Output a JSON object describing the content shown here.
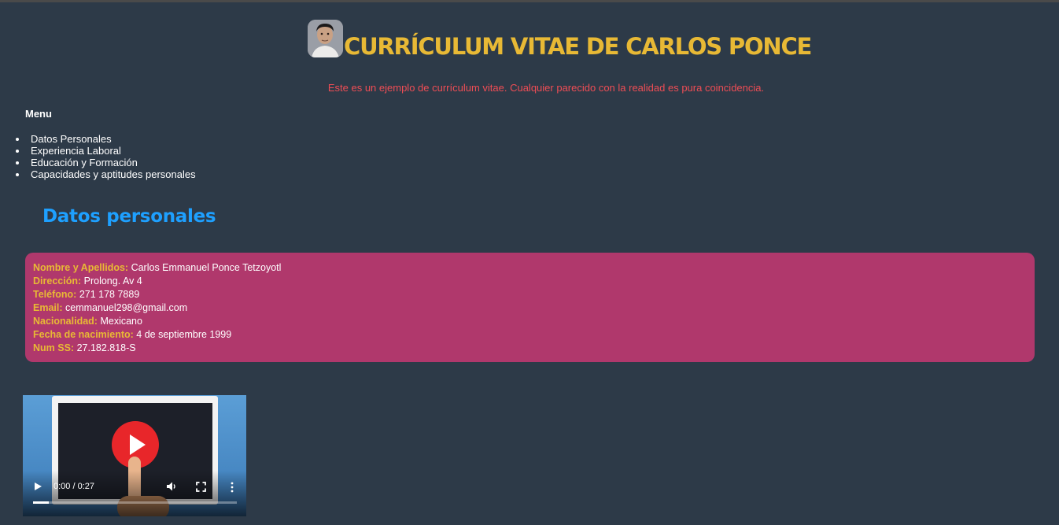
{
  "header": {
    "title": "CURRÍCULUM VITAE DE CARLOS PONCE",
    "subtitle": "Este es un ejemplo de currículum vitae. Cualquier parecido con la realidad es pura coincidencia."
  },
  "menu": {
    "title": "Menu",
    "items": [
      {
        "label": "Datos Personales"
      },
      {
        "label": "Experiencia Laboral"
      },
      {
        "label": "Educación y Formación"
      },
      {
        "label": "Capacidades y aptitudes personales"
      }
    ]
  },
  "personal": {
    "heading": "Datos personales",
    "rows": [
      {
        "label": "Nombre y Apellidos:",
        "value": "Carlos Emmanuel Ponce Tetzoyotl"
      },
      {
        "label": "Dirección:",
        "value": "Prolong. Av 4"
      },
      {
        "label": "Teléfono:",
        "value": "271 178 7889"
      },
      {
        "label": "Email:",
        "value": "cemmanuel298@gmail.com"
      },
      {
        "label": "Nacionalidad:",
        "value": "Mexicano"
      },
      {
        "label": "Fecha de nacimiento:",
        "value": "4 de septiembre 1999"
      },
      {
        "label": "Num SS:",
        "value": "27.182.818-S"
      }
    ]
  },
  "video": {
    "time": "0:00 / 0:27",
    "progress": 0.0
  },
  "colors": {
    "background": "#2d3a48",
    "title": "#e8b935",
    "subtitle": "#ef4d55",
    "heading": "#1ea0ff",
    "card": "#b0386c",
    "card_label": "#e8b935"
  },
  "icons": {
    "avatar": "profile-photo",
    "video_play": "play-icon",
    "volume": "volume-icon",
    "fullscreen": "fullscreen-icon",
    "more": "more-vert-icon"
  }
}
